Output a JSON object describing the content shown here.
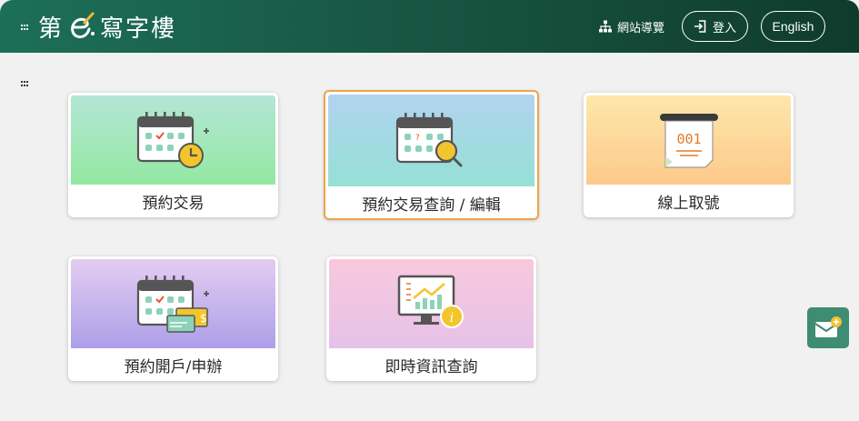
{
  "header": {
    "logo_prefix": "第",
    "logo_suffix": "寫字樓",
    "sitemap_label": "網站導覽",
    "login_label": "登入",
    "language_label": "English"
  },
  "services": [
    {
      "label": "預約交易",
      "icon": "calendar-clock-icon"
    },
    {
      "label": "預約交易查詢 / 編輯",
      "icon": "calendar-search-icon"
    },
    {
      "label": "線上取號",
      "icon": "queue-ticket-icon",
      "ticket_number": "001"
    },
    {
      "label": "預約開戶/申辦",
      "icon": "calendar-card-icon"
    },
    {
      "label": "即時資訊查詢",
      "icon": "monitor-chart-icon"
    }
  ],
  "colors": {
    "header_start": "#1d6f58",
    "header_end": "#0f3b2c",
    "selected_border": "#eba64a",
    "floating_button": "#3e8c73"
  }
}
